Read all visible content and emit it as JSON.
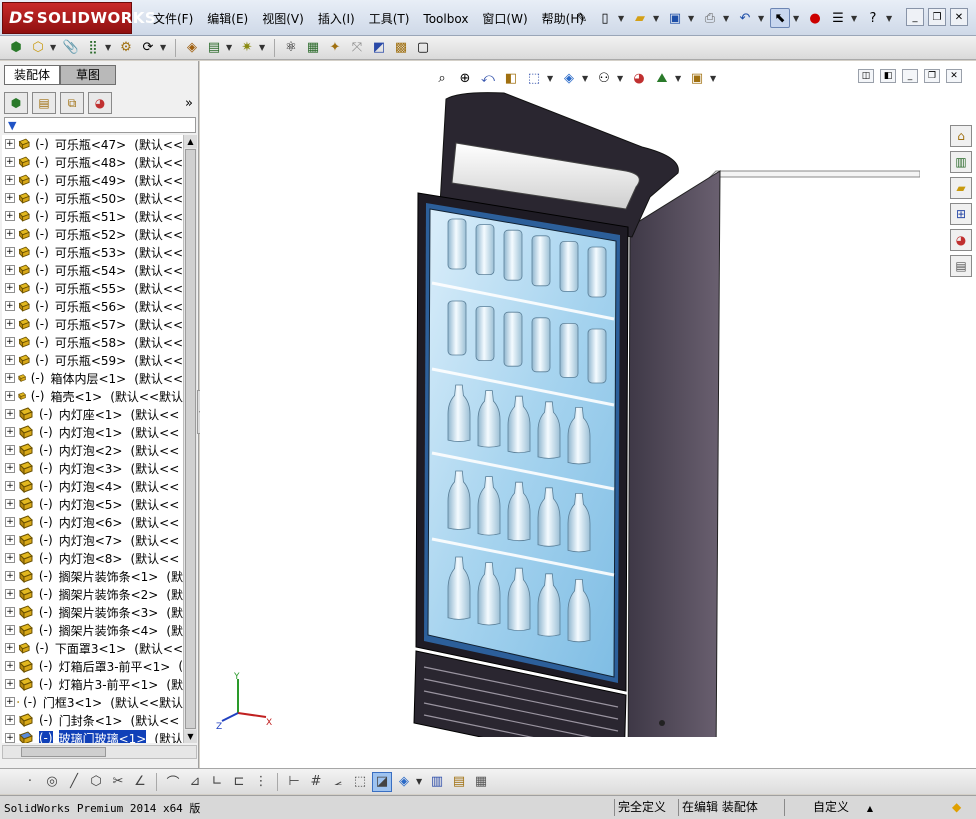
{
  "app": {
    "logo_text": "SOLIDWORKS",
    "logo_prefix": "DS"
  },
  "menu": [
    "文件(F)",
    "编辑(E)",
    "视图(V)",
    "插入(I)",
    "工具(T)",
    "Toolbox",
    "窗口(W)",
    "帮助(H)"
  ],
  "tabs": [
    "装配体",
    "草图"
  ],
  "tree": {
    "items": [
      {
        "label": "可乐瓶<47>",
        "suffix": "(默认<<"
      },
      {
        "label": "可乐瓶<48>",
        "suffix": "(默认<<"
      },
      {
        "label": "可乐瓶<49>",
        "suffix": "(默认<<"
      },
      {
        "label": "可乐瓶<50>",
        "suffix": "(默认<<"
      },
      {
        "label": "可乐瓶<51>",
        "suffix": "(默认<<"
      },
      {
        "label": "可乐瓶<52>",
        "suffix": "(默认<<"
      },
      {
        "label": "可乐瓶<53>",
        "suffix": "(默认<<"
      },
      {
        "label": "可乐瓶<54>",
        "suffix": "(默认<<"
      },
      {
        "label": "可乐瓶<55>",
        "suffix": "(默认<<"
      },
      {
        "label": "可乐瓶<56>",
        "suffix": "(默认<<"
      },
      {
        "label": "可乐瓶<57>",
        "suffix": "(默认<<"
      },
      {
        "label": "可乐瓶<58>",
        "suffix": "(默认<<"
      },
      {
        "label": "可乐瓶<59>",
        "suffix": "(默认<<"
      },
      {
        "label": "箱体内层<1>",
        "suffix": "(默认<<"
      },
      {
        "label": "箱壳<1>",
        "suffix": "(默认<<默认"
      },
      {
        "label": "内灯座<1>",
        "suffix": "(默认<<"
      },
      {
        "label": "内灯泡<1>",
        "suffix": "(默认<<"
      },
      {
        "label": "内灯泡<2>",
        "suffix": "(默认<<"
      },
      {
        "label": "内灯泡<3>",
        "suffix": "(默认<<"
      },
      {
        "label": "内灯泡<4>",
        "suffix": "(默认<<"
      },
      {
        "label": "内灯泡<5>",
        "suffix": "(默认<<"
      },
      {
        "label": "内灯泡<6>",
        "suffix": "(默认<<"
      },
      {
        "label": "内灯泡<7>",
        "suffix": "(默认<<"
      },
      {
        "label": "内灯泡<8>",
        "suffix": "(默认<<"
      },
      {
        "label": "搁架片装饰条<1>",
        "suffix": "(默"
      },
      {
        "label": "搁架片装饰条<2>",
        "suffix": "(默"
      },
      {
        "label": "搁架片装饰条<3>",
        "suffix": "(默"
      },
      {
        "label": "搁架片装饰条<4>",
        "suffix": "(默"
      },
      {
        "label": "下面罩3<1>",
        "suffix": "(默认<<"
      },
      {
        "label": "灯箱后罩3-前平<1>",
        "suffix": "("
      },
      {
        "label": "灯箱片3-前平<1>",
        "suffix": "(默"
      },
      {
        "label": "门框3<1>",
        "suffix": "(默认<<默认"
      },
      {
        "label": "门封条<1>",
        "suffix": "(默认<<"
      },
      {
        "label": "玻璃门玻璃<1>",
        "suffix": "(默认"
      }
    ],
    "prefix": "(-)",
    "selected_index": 33
  },
  "status": {
    "left": "SolidWorks Premium 2014 x64 版",
    "cells": [
      "完全定义",
      "在编辑 装配体",
      "自定义"
    ]
  },
  "icons": {
    "title_tools": [
      "new-document-icon",
      "open-icon",
      "save-icon",
      "print-icon",
      "undo-icon",
      "select-icon",
      "rebuild-icon",
      "options-icon",
      "help-icon"
    ],
    "viewport_tools": [
      "zoom-to-fit-icon",
      "zoom-area-icon",
      "previous-view-icon",
      "section-view-icon",
      "view-orientation-icon",
      "display-style-icon",
      "hide-show-icon",
      "appearance-icon",
      "scene-icon",
      "view-settings-icon"
    ],
    "task_pane": [
      "home-icon",
      "design-library-icon",
      "file-explorer-icon",
      "view-palette-icon",
      "appearances-icon",
      "custom-properties-icon"
    ]
  },
  "colors": {
    "selection": "#1040b8",
    "logo_red": "#b01c1c",
    "cabinet_side": "#5a5060"
  }
}
